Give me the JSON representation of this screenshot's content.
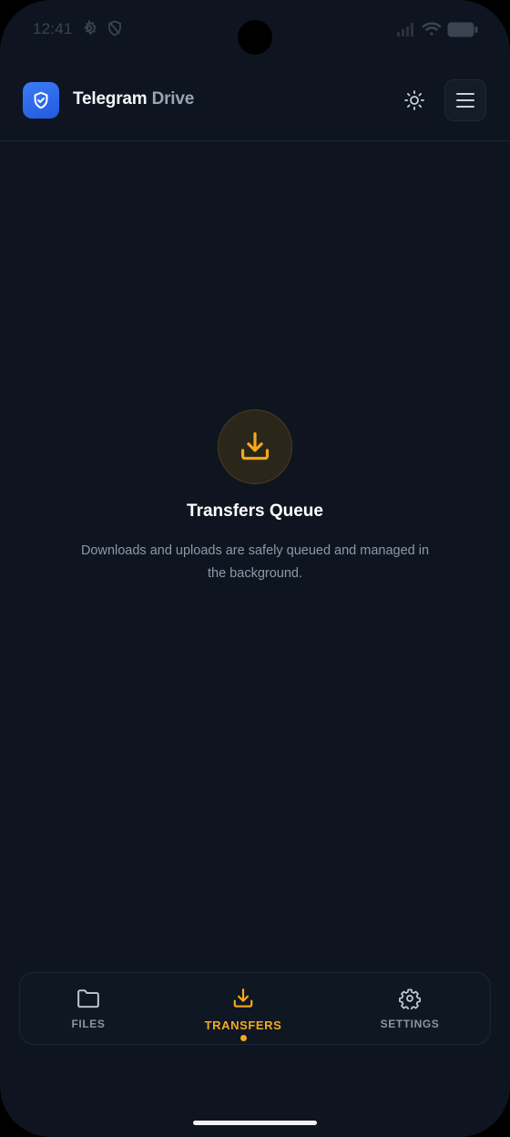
{
  "status_bar": {
    "time": "12:41",
    "icons": [
      "settings-icon",
      "shield-off-icon",
      "signal-icon",
      "wifi-icon",
      "battery-icon"
    ]
  },
  "header": {
    "title_primary": "Telegram",
    "title_accent": "Drive",
    "logo_icon": "shield-check-icon",
    "theme_icon": "sun-icon",
    "menu_icon": "hamburger-menu-icon"
  },
  "empty_state": {
    "icon": "download-tray-icon",
    "title": "Transfers Queue",
    "description": "Downloads and uploads are safely queued and managed in the background."
  },
  "bottom_nav": {
    "items": [
      {
        "label": "FILES",
        "icon": "folder-icon",
        "active": false
      },
      {
        "label": "TRANSFERS",
        "icon": "download-tray-icon",
        "active": true
      },
      {
        "label": "SETTINGS",
        "icon": "gear-icon",
        "active": false
      }
    ]
  },
  "colors": {
    "background": "#0e1520",
    "accent": "#f4a91c",
    "brand_blue": "#2f6bf0",
    "text_primary": "#ffffff",
    "text_muted": "#8e98a7"
  }
}
